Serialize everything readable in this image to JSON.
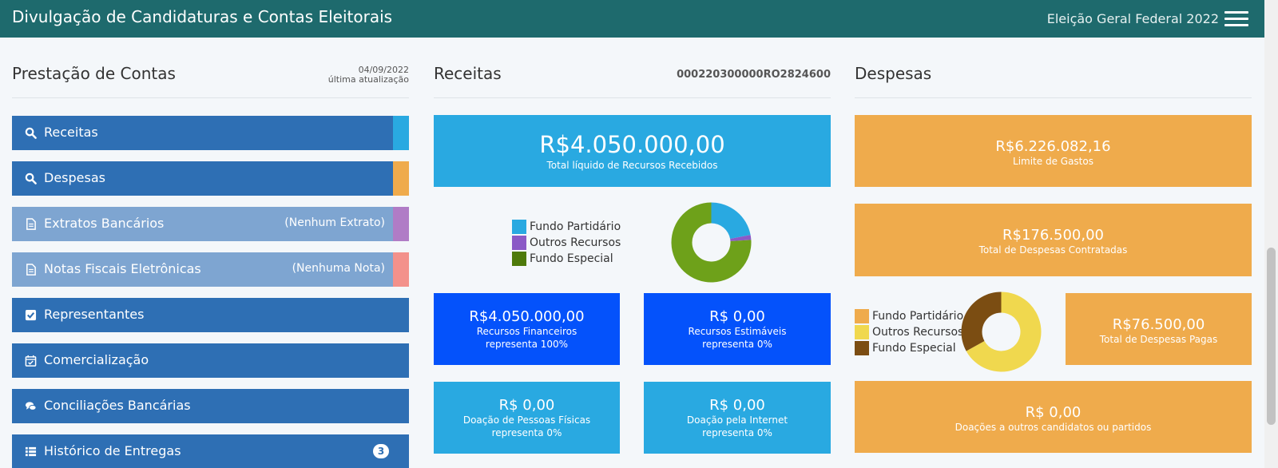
{
  "header": {
    "title": "Divulgação de Candidaturas e Contas Eleitorais",
    "election": "Eleição Geral Federal 2022"
  },
  "prestacao": {
    "title": "Prestação de Contas",
    "date": "04/09/2022",
    "update_label": "última atualização",
    "items": [
      {
        "label": "Receitas",
        "note": "",
        "icon": "search-icon",
        "stripe": "#29a9e1"
      },
      {
        "label": "Despesas",
        "note": "",
        "icon": "search-icon",
        "stripe": "#efab4c"
      },
      {
        "label": "Extratos Bancários",
        "note": "(Nenhum Extrato)",
        "icon": "document-icon",
        "stripe": "#b07cc6"
      },
      {
        "label": "Notas Fiscais Eletrônicas",
        "note": "(Nenhuma Nota)",
        "icon": "document-icon",
        "stripe": "#f3918b"
      },
      {
        "label": "Representantes",
        "note": "",
        "icon": "checkbox-icon"
      },
      {
        "label": "Comercialização",
        "note": "",
        "icon": "calendar-check-icon"
      },
      {
        "label": "Conciliações Bancárias",
        "note": "",
        "icon": "chat-icon"
      },
      {
        "label": "Histórico de Entregas",
        "note": "",
        "icon": "list-icon",
        "badge": "3"
      }
    ]
  },
  "receitas": {
    "title": "Receitas",
    "protocol": "000220300000RO2824600",
    "total_value": "R$4.050.000,00",
    "total_label": "Total líquido de Recursos Recebidos",
    "legend": [
      {
        "label": "Fundo Partidário",
        "color": "#29a9e1"
      },
      {
        "label": "Outros Recursos",
        "color": "#8a5ac6"
      },
      {
        "label": "Fundo Especial",
        "color": "#4e7a0a"
      }
    ],
    "donut": [
      {
        "name": "Fundo Partidário",
        "value": 22,
        "color": "#29a9e1"
      },
      {
        "name": "Outros Recursos",
        "value": 2,
        "color": "#8a5ac6"
      },
      {
        "name": "Fundo Especial",
        "value": 76,
        "color": "#6ea11a"
      }
    ],
    "cards": [
      {
        "value": "R$4.050.000,00",
        "line1": "Recursos Financeiros",
        "line2": "representa 100%"
      },
      {
        "value": "R$ 0,00",
        "line1": "Recursos Estimáveis",
        "line2": "representa 0%"
      },
      {
        "value": "R$ 0,00",
        "line1": "Doação de Pessoas Físicas",
        "line2": "representa 0%"
      },
      {
        "value": "R$ 0,00",
        "line1": "Doação pela Internet",
        "line2": "representa 0%"
      }
    ]
  },
  "despesas": {
    "title": "Despesas",
    "limite_value": "R$6.226.082,16",
    "limite_label": "Limite de Gastos",
    "contratadas_value": "R$176.500,00",
    "contratadas_label": "Total de Despesas Contratadas",
    "pagas_value": "R$76.500,00",
    "pagas_label": "Total de Despesas Pagas",
    "doacoes_value": "R$ 0,00",
    "doacoes_label": "Doações a outros candidatos ou partidos",
    "legend": [
      {
        "label": "Fundo Partidário",
        "color": "#efab4c"
      },
      {
        "label": "Outros Recursos",
        "color": "#f0d84e"
      },
      {
        "label": "Fundo Especial",
        "color": "#7b4d12"
      }
    ],
    "donut": [
      {
        "name": "Fundo Partidário",
        "value": 0,
        "color": "#efab4c"
      },
      {
        "name": "Outros Recursos",
        "value": 67,
        "color": "#f0d84e"
      },
      {
        "name": "Fundo Especial",
        "value": 33,
        "color": "#7b4d12"
      }
    ]
  }
}
